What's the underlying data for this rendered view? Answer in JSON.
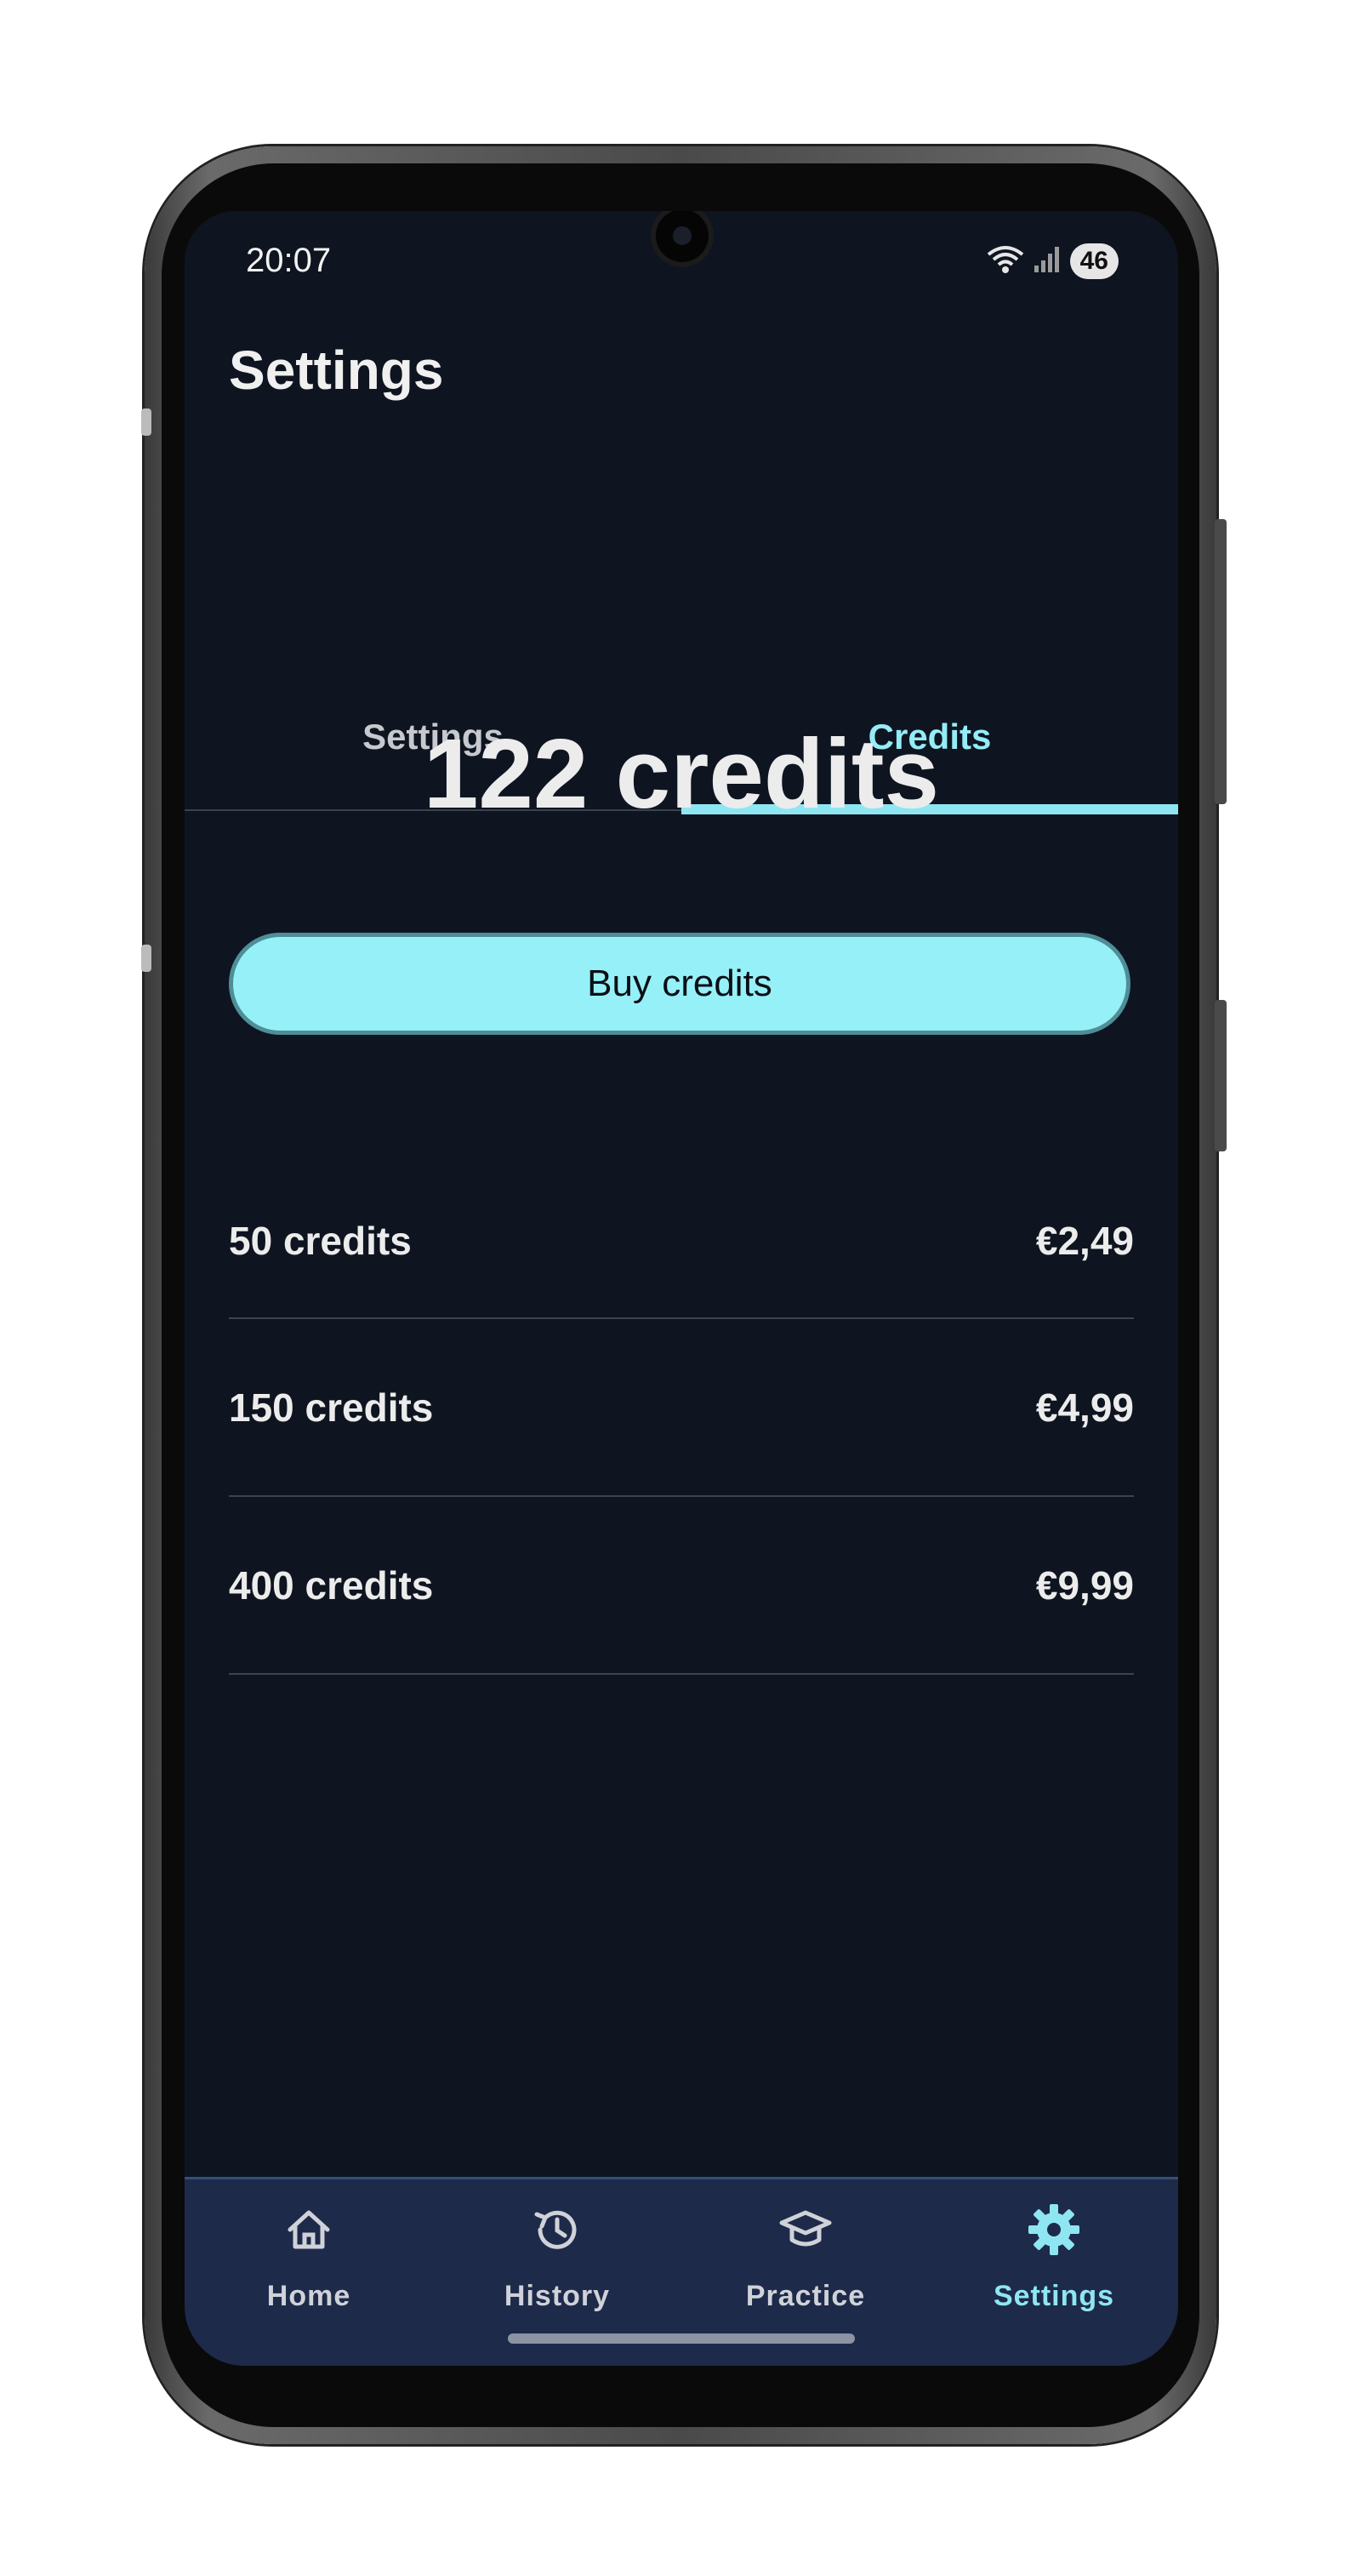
{
  "status_bar": {
    "time": "20:07",
    "battery": "46"
  },
  "header": {
    "title": "Settings"
  },
  "tabs": [
    {
      "label": "Settings",
      "active": false
    },
    {
      "label": "Credits",
      "active": true
    }
  ],
  "credits": {
    "balance": "122 credits",
    "buy_label": "Buy credits",
    "packages": [
      {
        "amount": "50 credits",
        "price": "€2,49"
      },
      {
        "amount": "150 credits",
        "price": "€4,99"
      },
      {
        "amount": "400 credits",
        "price": "€9,99"
      }
    ]
  },
  "bottom_nav": [
    {
      "label": "Home",
      "icon": "home-icon"
    },
    {
      "label": "History",
      "icon": "history-icon"
    },
    {
      "label": "Practice",
      "icon": "graduation-cap-icon"
    },
    {
      "label": "Settings",
      "icon": "gear-icon",
      "active": true
    }
  ],
  "colors": {
    "background": "#0e1520",
    "accent": "#95ecf6",
    "nav_background": "#1e2a4a"
  }
}
